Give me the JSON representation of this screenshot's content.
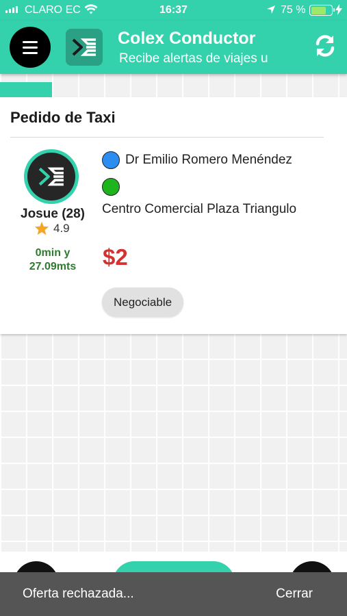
{
  "status_bar": {
    "carrier": "CLARO EC",
    "time": "16:37",
    "battery_percent": "75 %",
    "battery_level": 0.75
  },
  "header": {
    "title": "Colex Conductor",
    "subtitle": "Recibe alertas de viajes u",
    "menu_icon": "hamburger-menu-icon",
    "refresh_icon": "refresh-icon"
  },
  "progress": {
    "fraction": 0.15
  },
  "order_card": {
    "title": "Pedido de Taxi",
    "passenger": {
      "name": "Josue (28)",
      "rating": "4.9",
      "distance_line1": "0min y",
      "distance_line2": "27.09mts"
    },
    "origin": "Dr Emilio Romero Menéndez",
    "destination": "Centro Comercial Plaza Triangulo",
    "price": "$2",
    "tag": "Negociable"
  },
  "snackbar": {
    "message": "Oferta rechazada...",
    "action": "Cerrar"
  },
  "colors": {
    "accent": "#34d1ad",
    "origin_dot": "#2d8cf0",
    "destination_dot": "#1eb41e",
    "price": "#d43232",
    "distance": "#2e7a2e"
  }
}
